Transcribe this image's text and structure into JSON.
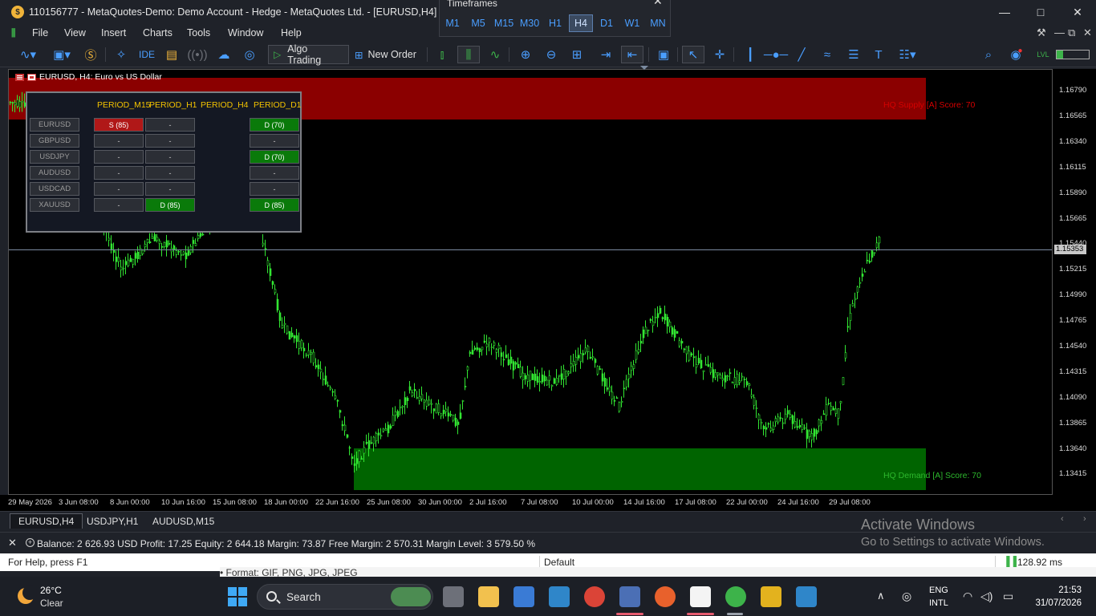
{
  "window": {
    "title": "110156777 - MetaQuotes-Demo: Demo Account - Hedge - MetaQuotes Ltd. - [EURUSD,H4]",
    "minimize_icon": "minimize-icon",
    "maximize_icon": "maximize-icon",
    "close_icon": "close-icon"
  },
  "menu": {
    "items": [
      "File",
      "View",
      "Insert",
      "Charts",
      "Tools",
      "Window",
      "Help"
    ]
  },
  "toolbar": {
    "algo_trading": "Algo Trading",
    "new_order": "New Order",
    "ide": "IDE"
  },
  "timeframes": {
    "title": "Timeframes",
    "items": [
      "M1",
      "M5",
      "M15",
      "M30",
      "H1",
      "H4",
      "D1",
      "W1",
      "MN"
    ],
    "active": "H4"
  },
  "chart": {
    "header": "EURUSD, H4:  Euro vs US Dollar",
    "current_price": "1.15353",
    "price_labels": [
      "1.16790",
      "1.16565",
      "1.16340",
      "1.16115",
      "1.15890",
      "1.15665",
      "1.15440",
      "1.15215",
      "1.14990",
      "1.14765",
      "1.14540",
      "1.14315",
      "1.14090",
      "1.13865",
      "1.13640",
      "1.13415"
    ],
    "time_labels": [
      "29 May 2026",
      "3 Jun 08:00",
      "8 Jun 00:00",
      "10 Jun 16:00",
      "15 Jun 08:00",
      "18 Jun 00:00",
      "22 Jun 16:00",
      "25 Jun 08:00",
      "30 Jun 00:00",
      "2 Jul 16:00",
      "7 Jul 08:00",
      "10 Jul 00:00",
      "14 Jul 16:00",
      "17 Jul 08:00",
      "22 Jul 00:00",
      "24 Jul 16:00",
      "29 Jul 08:00"
    ],
    "supply_label": "HQ Supply [A] Score: 70",
    "demand_label": "HQ Demand [A] Score: 70",
    "colors": {
      "supply": "#8b0000",
      "demand": "#006400",
      "candles": "#32e632"
    }
  },
  "dashboard": {
    "columns": [
      "PERIOD_M15",
      "PERIOD_H1",
      "PERIOD_H4",
      "PERIOD_D1"
    ],
    "rows": [
      {
        "symbol": "EURUSD",
        "cells": [
          "S (85)",
          "-",
          "",
          "D (70)"
        ],
        "colors": [
          "red",
          "",
          "",
          "green"
        ]
      },
      {
        "symbol": "GBPUSD",
        "cells": [
          "-",
          "-",
          "",
          "-"
        ],
        "colors": [
          "",
          "",
          "",
          ""
        ]
      },
      {
        "symbol": "USDJPY",
        "cells": [
          "-",
          "-",
          "",
          "D (70)"
        ],
        "colors": [
          "",
          "",
          "",
          "green"
        ]
      },
      {
        "symbol": "AUDUSD",
        "cells": [
          "-",
          "-",
          "",
          "-"
        ],
        "colors": [
          "",
          "",
          "",
          ""
        ]
      },
      {
        "symbol": "USDCAD",
        "cells": [
          "-",
          "-",
          "",
          "-"
        ],
        "colors": [
          "",
          "",
          "",
          ""
        ]
      },
      {
        "symbol": "XAUUSD",
        "cells": [
          "-",
          "D (85)",
          "",
          "D (85)"
        ],
        "colors": [
          "",
          "green",
          "",
          "green"
        ]
      }
    ]
  },
  "tabs": [
    "EURUSD,H4",
    "USDJPY,H1",
    "AUDUSD,M15"
  ],
  "account": {
    "summary": "Balance: 2 626.93 USD  Profit: 17.25  Equity: 2 644.18  Margin: 73.87  Free Margin: 2 570.31  Margin Level: 3 579.50 %"
  },
  "activation": {
    "line1": "Activate Windows",
    "line2": "Go to Settings to activate Windows."
  },
  "status": {
    "help": "For Help, press F1",
    "profile": "Default",
    "ping": "128.92 ms"
  },
  "behind_text": "• Format: GIF, PNG, JPG, JPEG",
  "taskbar": {
    "weather_temp": "26°C",
    "weather_cond": "Clear",
    "search": "Search",
    "lang1": "ENG",
    "lang2": "INTL",
    "time": "21:53",
    "date": "31/07/2026"
  }
}
